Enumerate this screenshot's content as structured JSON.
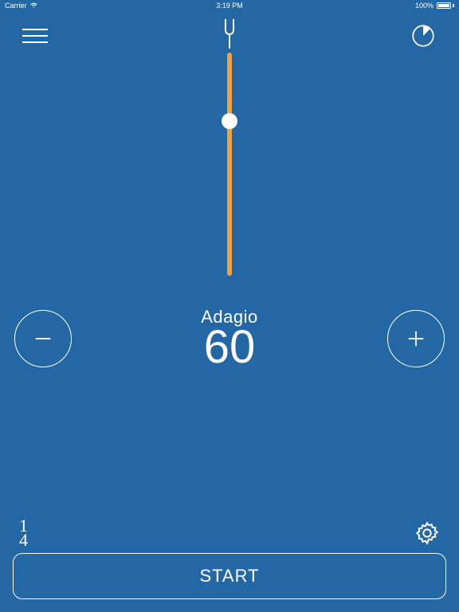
{
  "status": {
    "carrier": "Carrier",
    "time": "3:19 PM",
    "battery": "100%"
  },
  "tempo": {
    "label": "Adagio",
    "value": "60"
  },
  "time_signature": {
    "top": "1",
    "bottom": "4"
  },
  "buttons": {
    "start": "START"
  },
  "colors": {
    "bg": "#2368a5",
    "accent": "#f2a23a"
  }
}
